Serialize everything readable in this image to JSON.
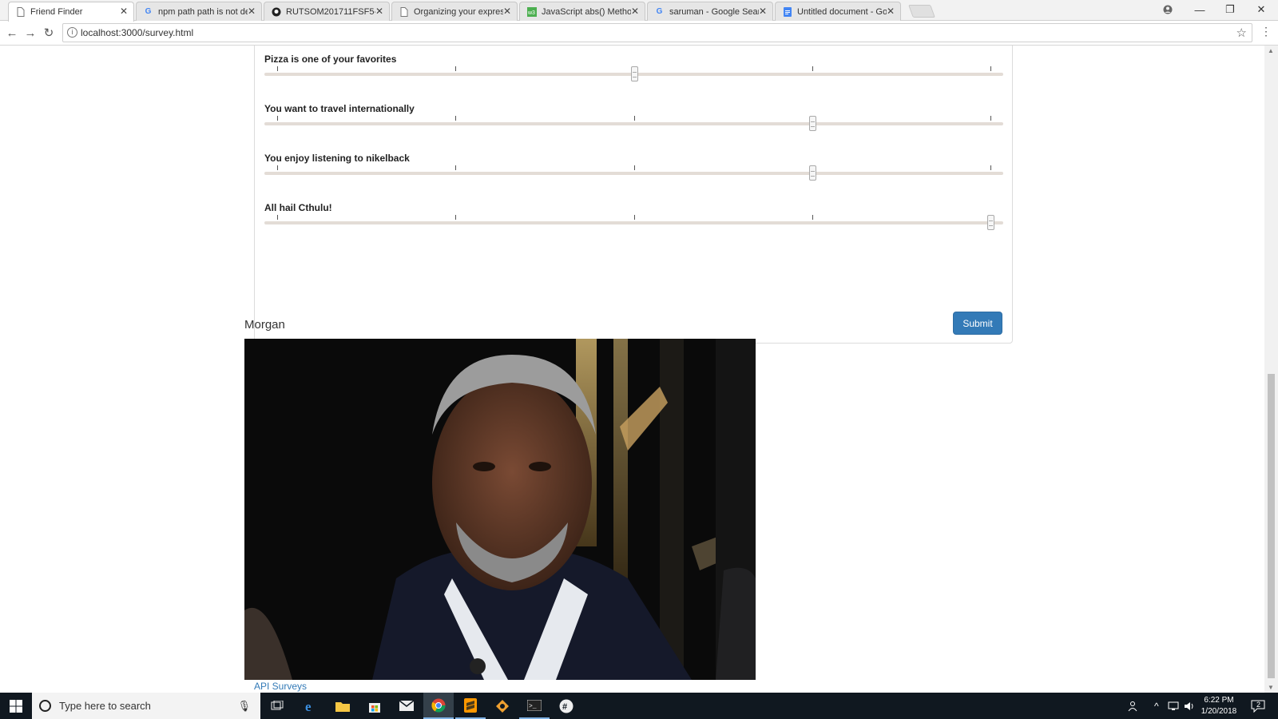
{
  "browser": {
    "tabs": [
      {
        "title": "Friend Finder",
        "icon": "page-icon",
        "active": true
      },
      {
        "title": "npm path path is not def",
        "icon": "google-icon"
      },
      {
        "title": "RUTSOM201711FSF5-FT",
        "icon": "github-icon"
      },
      {
        "title": "Organizing your express",
        "icon": "page-icon"
      },
      {
        "title": "JavaScript abs() Method",
        "icon": "w3schools-icon"
      },
      {
        "title": "saruman - Google Search",
        "icon": "google-icon"
      },
      {
        "title": "Untitled document - Goo",
        "icon": "docs-icon"
      }
    ],
    "url": "localhost:3000/survey.html"
  },
  "survey": {
    "scale_max": 5,
    "questions": [
      {
        "label": "Pizza is one of your favorites",
        "value": 3
      },
      {
        "label": "You want to travel internationally",
        "value": 4
      },
      {
        "label": "You enjoy listening to nikelback",
        "value": 4
      },
      {
        "label": "All hail Cthulu!",
        "value": 5
      }
    ],
    "submit_label": "Submit"
  },
  "match": {
    "name": "Morgan",
    "photo_alt": "Morgan"
  },
  "footer": {
    "link_label": "API Surveys"
  },
  "taskbar": {
    "search_placeholder": "Type here to search",
    "time": "6:22 PM",
    "date": "1/20/2018",
    "notification_count": "2"
  },
  "colors": {
    "primary": "#337ab7",
    "taskbar": "#101820",
    "track": "#e3dcd6"
  }
}
